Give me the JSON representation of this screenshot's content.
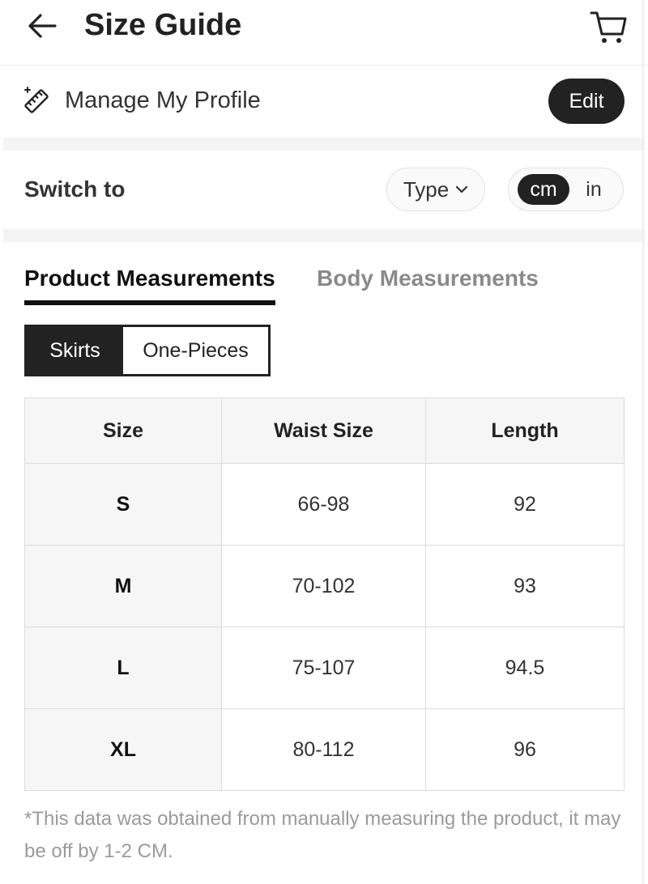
{
  "header": {
    "title": "Size Guide",
    "back_icon": "arrow-left-icon",
    "cart_icon": "cart-icon"
  },
  "profile": {
    "icon": "ruler-sparkle-icon",
    "label": "Manage My Profile",
    "edit_label": "Edit"
  },
  "switch": {
    "label": "Switch to",
    "type_label": "Type",
    "units": [
      "cm",
      "in"
    ],
    "selected_unit": "cm"
  },
  "tabs": [
    {
      "label": "Product Measurements",
      "active": true
    },
    {
      "label": "Body Measurements",
      "active": false
    }
  ],
  "categories": [
    {
      "label": "Skirts",
      "active": true
    },
    {
      "label": "One-Pieces",
      "active": false
    }
  ],
  "table": {
    "headers": [
      "Size",
      "Waist Size",
      "Length"
    ],
    "rows": [
      [
        "S",
        "66-98",
        "92"
      ],
      [
        "M",
        "70-102",
        "93"
      ],
      [
        "L",
        "75-107",
        "94.5"
      ],
      [
        "XL",
        "80-112",
        "96"
      ]
    ]
  },
  "footnote": "*This data was obtained from manually measuring the product, it may be off by 1-2 CM.",
  "colors": {
    "primary_dark": "#222222",
    "inactive_text": "#8a8a8a",
    "section_gap": "#f4f4f4",
    "table_border": "#dcdcdc"
  }
}
